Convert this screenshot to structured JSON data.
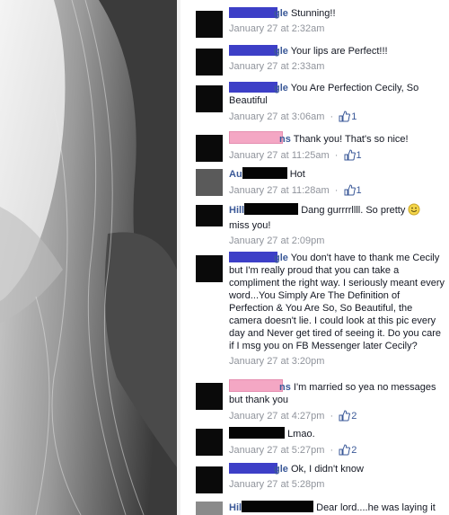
{
  "comments": [
    {
      "name_suffix": "gle",
      "text": "Stunning!!",
      "time": "January 27 at 2:32am",
      "likes": ""
    },
    {
      "name_suffix": "gle",
      "text": "Your lips are Perfect!!!",
      "time": "January 27 at 2:33am",
      "likes": ""
    },
    {
      "name_suffix": "gle",
      "text": "You Are Perfection Cecily, So Beautiful",
      "time": "January 27 at 3:06am",
      "likes": "1"
    },
    {
      "name_suffix": "ns",
      "text": "Thank you! That's so nice!",
      "time": "January 27 at 11:25am",
      "likes": "1"
    },
    {
      "name_prefix": "Au",
      "text": "Hot",
      "time": "January 27 at 11:28am",
      "likes": "1"
    },
    {
      "name_prefix": "Hill",
      "text": "Dang gurrrrllll. So pretty",
      "text2": "miss you!",
      "time": "January 27 at 2:09pm",
      "likes": ""
    },
    {
      "name_suffix": "gle",
      "text": "You don't have to thank me Cecily but I'm really proud that you can take a compliment the right way. I seriously meant every word...You Simply Are The Definition of Perfection & You Are So, So Beautiful, the camera doesn't lie. I could look at this pic every day and Never get tired of seeing it. Do you care if I msg you on FB Messenger later Cecily?",
      "time": "January 27 at 3:20pm",
      "likes": ""
    },
    {
      "name_suffix": "ns",
      "text": "I'm married so yea no messages but thank you",
      "time": "January 27 at 4:27pm",
      "likes": "2"
    },
    {
      "text": "Lmao.",
      "time": "January 27 at 5:27pm",
      "likes": "2"
    },
    {
      "name_suffix": "gle",
      "text": "Ok, I didn't know",
      "time": "January 27 at 5:28pm",
      "likes": ""
    },
    {
      "name_prefix": "Hil",
      "text": "Dear lord....he was laying it on",
      "time": "",
      "likes": ""
    }
  ],
  "meta": {
    "dot": "·"
  },
  "colors": {
    "name": "#3b5998",
    "meta": "#90949c",
    "redact_blue": "#3d3fc7",
    "redact_pink": "#f4a7c4"
  }
}
